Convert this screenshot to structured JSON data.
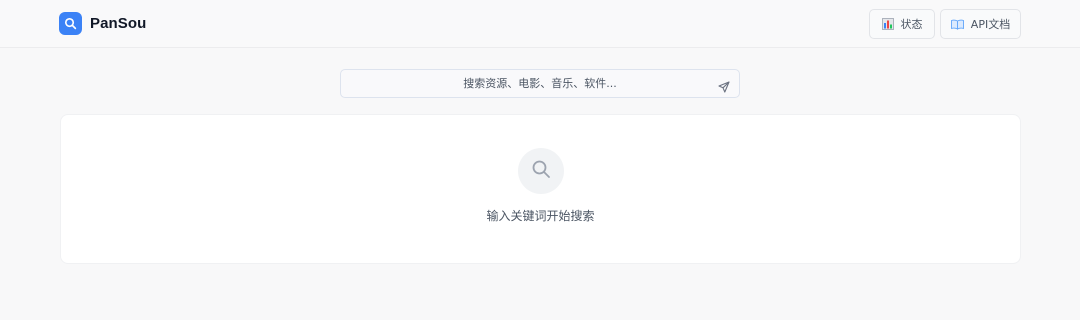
{
  "header": {
    "brand": "PanSou",
    "status_label": "状态",
    "api_label": "API文档"
  },
  "search": {
    "placeholder": "搜索资源、电影、音乐、软件..."
  },
  "empty_state": {
    "message": "输入关键词开始搜索"
  },
  "icons": {
    "logo": "search-icon",
    "status": "bar-chart-icon",
    "api": "open-book-icon",
    "submit": "send-icon",
    "empty": "search-icon"
  },
  "colors": {
    "accent": "#3b82f6",
    "background": "#f8f8f9",
    "card": "#ffffff"
  }
}
